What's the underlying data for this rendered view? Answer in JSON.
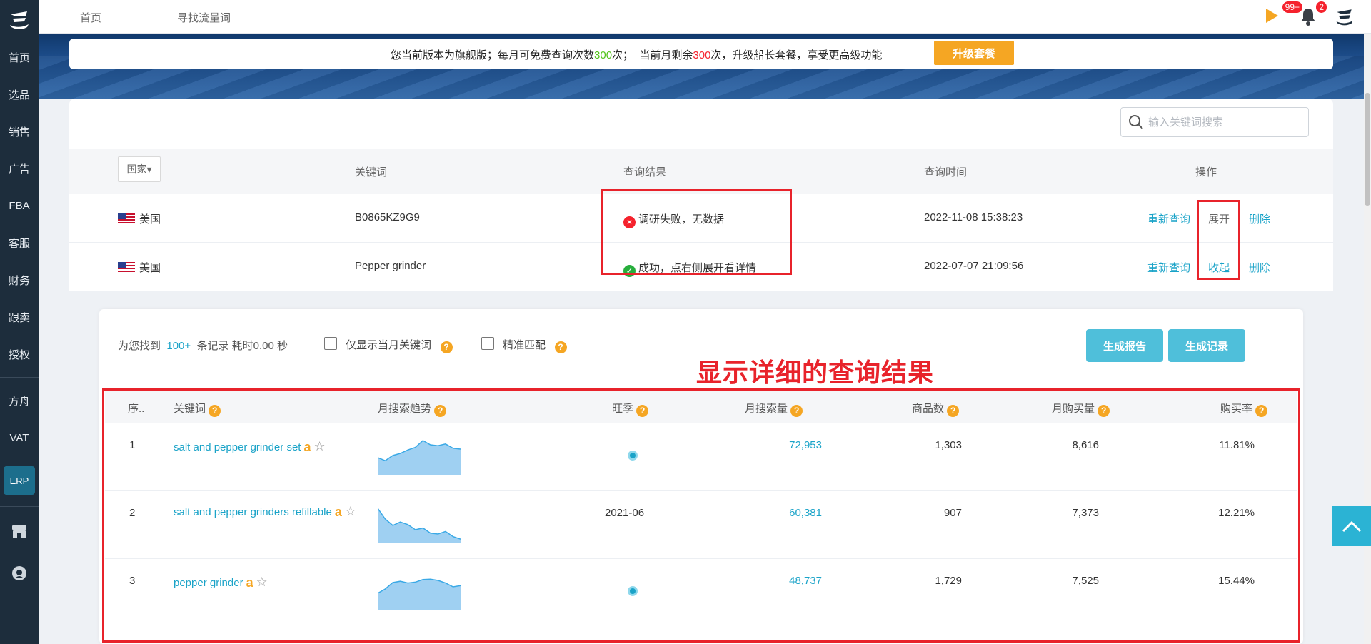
{
  "sidebar": {
    "items": [
      {
        "label": "首页"
      },
      {
        "label": "选品"
      },
      {
        "label": "销售"
      },
      {
        "label": "广告"
      },
      {
        "label": "FBA"
      },
      {
        "label": "客服"
      },
      {
        "label": "财务"
      },
      {
        "label": "跟卖"
      },
      {
        "label": "授权"
      }
    ],
    "fangzhou": "方舟",
    "vat": "VAT",
    "erp": "ERP"
  },
  "topbar": {
    "tabs": [
      "首页",
      "寻找流量词"
    ],
    "flag_badge": "99+",
    "bell_badge": "2"
  },
  "notice": {
    "part1": "您当前版本为旗舰版；每月可免费查询次数",
    "monthly_quota": "300",
    "part2": "次；  当前月剩余",
    "remaining": "300",
    "part3": "次，升级船长套餐，享受更高级功能",
    "upgrade_label": "升级套餐"
  },
  "search": {
    "placeholder": "输入关键词搜索"
  },
  "history_table": {
    "country_select": "国家▾",
    "headers": {
      "keyword": "关键词",
      "result": "查询结果",
      "time": "查询时间",
      "actions": "操作"
    },
    "rows": [
      {
        "country": "美国",
        "keyword": "B0865KZ9G9",
        "result": "调研失败，无数据",
        "result_status": "fail",
        "time": "2022-11-08 15:38:23",
        "requery": "重新查询",
        "toggle": "展开",
        "delete": "删除"
      },
      {
        "country": "美国",
        "keyword": "Pepper grinder",
        "result": "成功，点右侧展开看详情",
        "result_status": "success",
        "time": "2022-07-07 21:09:56",
        "requery": "重新查询",
        "toggle": "收起",
        "delete": "删除"
      }
    ]
  },
  "detail": {
    "summary_prefix": "为您找到",
    "summary_count": "100+",
    "summary_suffix": "条记录 耗时0.00 秒",
    "only_this_month": "仅显示当月关键词",
    "exact_match": "精准匹配",
    "gen_report": "生成报告",
    "gen_record": "生成记录",
    "annotation": "显示详细的查询结果",
    "headers": {
      "index": "序..",
      "keyword": "关键词",
      "trend": "月搜索趋势",
      "season": "旺季",
      "volume": "月搜索量",
      "products": "商品数",
      "purchases": "月购买量",
      "purchase_rate": "购买率"
    },
    "rows": [
      {
        "index": "1",
        "keyword": "salt and pepper grinder set",
        "season": "",
        "volume": "72,953",
        "products": "1,303",
        "purchases": "8,616",
        "purchase_rate": "11.81%",
        "trend": [
          40,
          33,
          45,
          50,
          58,
          64,
          80,
          70,
          68,
          72,
          62,
          60
        ]
      },
      {
        "index": "2",
        "keyword": "salt and pepper grinders refillable",
        "season": "2021-06",
        "volume": "60,381",
        "products": "907",
        "purchases": "7,373",
        "purchase_rate": "12.21%",
        "trend": [
          80,
          55,
          40,
          48,
          42,
          30,
          34,
          22,
          20,
          26,
          14,
          8
        ]
      },
      {
        "index": "3",
        "keyword": "pepper grinder",
        "season": "",
        "volume": "48,737",
        "products": "1,729",
        "purchases": "7,525",
        "purchase_rate": "15.44%",
        "trend": [
          40,
          50,
          65,
          68,
          64,
          66,
          72,
          73,
          70,
          64,
          55,
          58
        ]
      }
    ]
  },
  "colors": {
    "accent": "#1aa3c8",
    "sidebar": "#1d2d3c",
    "warning": "#f5a623",
    "annotation": "#e8232b"
  }
}
